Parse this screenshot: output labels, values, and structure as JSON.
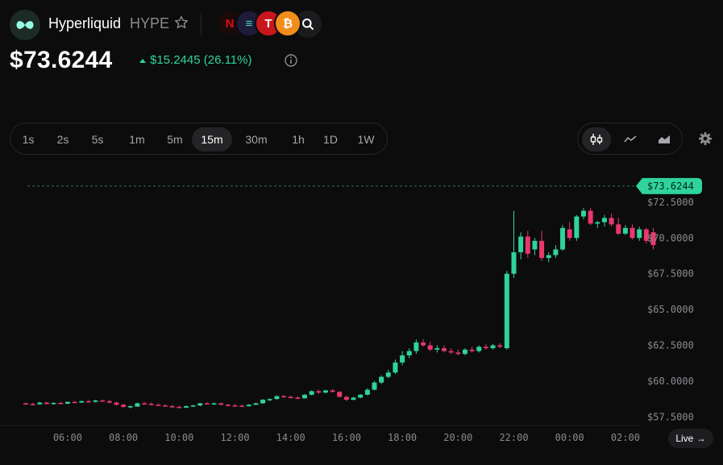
{
  "header": {
    "asset_name": "Hyperliquid",
    "ticker": "HYPE",
    "star_icon": "star-outline-icon",
    "tokens": [
      {
        "name": "netflix-logo",
        "glyph": "N",
        "bg": "#1a0a0a",
        "fg": "#e50914"
      },
      {
        "name": "solana-logo",
        "glyph": "≡",
        "bg": "#1e1a3a",
        "fg": "#3fd6c4"
      },
      {
        "name": "tesla-logo",
        "glyph": "T",
        "bg": "#c8161d",
        "fg": "#ffffff"
      },
      {
        "name": "bitcoin-logo",
        "glyph": "₿",
        "bg": "#f28c1a",
        "fg": "#ffffff"
      }
    ],
    "search_icon": "search-icon"
  },
  "price": {
    "value": "$73.6244",
    "change": "$15.2445 (26.11%)",
    "direction": "up",
    "change_color": "#2fd39b"
  },
  "timeframes": {
    "items": [
      "1s",
      "2s",
      "5s",
      "1m",
      "5m",
      "15m",
      "30m",
      "1h",
      "1D",
      "1W"
    ],
    "active": "15m"
  },
  "chart_types": {
    "items": [
      "candlestick-icon",
      "line-chart-icon",
      "area-chart-icon"
    ],
    "active": "candlestick-icon"
  },
  "settings_icon": "gear-icon",
  "live_button": {
    "label": "Live →"
  },
  "colors": {
    "up": "#2fd39b",
    "down": "#e8386c",
    "background": "#0c0c0d"
  },
  "chart_data": {
    "type": "candlestick",
    "interval": "15m",
    "last_price_label": "$73.6244",
    "last_price": 73.6244,
    "y_ticks": [
      "$72.5000",
      "$70.0000",
      "$67.5000",
      "$65.0000",
      "$62.5000",
      "$60.0000",
      "$57.5000"
    ],
    "y_tick_values": [
      72.5,
      70,
      67.5,
      65,
      62.5,
      60,
      57.5
    ],
    "x_ticks": [
      "06:00",
      "08:00",
      "10:00",
      "12:00",
      "14:00",
      "16:00",
      "18:00",
      "20:00",
      "22:00",
      "00:00",
      "02:00"
    ],
    "ylim": [
      56.9,
      74.8
    ],
    "candles": [
      [
        58.45,
        58.5,
        58.35,
        58.4
      ],
      [
        58.4,
        58.48,
        58.32,
        58.38
      ],
      [
        58.38,
        58.55,
        58.35,
        58.5
      ],
      [
        58.5,
        58.55,
        58.38,
        58.4
      ],
      [
        58.4,
        58.52,
        58.36,
        58.48
      ],
      [
        58.48,
        58.55,
        58.4,
        58.42
      ],
      [
        58.42,
        58.58,
        58.4,
        58.55
      ],
      [
        58.55,
        58.62,
        58.45,
        58.5
      ],
      [
        58.5,
        58.65,
        58.48,
        58.6
      ],
      [
        58.6,
        58.68,
        58.5,
        58.55
      ],
      [
        58.55,
        58.7,
        58.52,
        58.65
      ],
      [
        58.65,
        58.72,
        58.55,
        58.6
      ],
      [
        58.6,
        58.7,
        58.45,
        58.5
      ],
      [
        58.5,
        58.58,
        58.3,
        58.35
      ],
      [
        58.35,
        58.42,
        58.15,
        58.2
      ],
      [
        58.2,
        58.3,
        58.1,
        58.25
      ],
      [
        58.22,
        58.5,
        58.2,
        58.45
      ],
      [
        58.45,
        58.55,
        58.38,
        58.42
      ],
      [
        58.42,
        58.5,
        58.3,
        58.35
      ],
      [
        58.35,
        58.45,
        58.28,
        58.3
      ],
      [
        58.3,
        58.4,
        58.22,
        58.25
      ],
      [
        58.25,
        58.35,
        58.15,
        58.2
      ],
      [
        58.2,
        58.3,
        58.12,
        58.15
      ],
      [
        58.15,
        58.3,
        58.12,
        58.25
      ],
      [
        58.25,
        58.35,
        58.2,
        58.3
      ],
      [
        58.3,
        58.48,
        58.25,
        58.45
      ],
      [
        58.45,
        58.52,
        58.38,
        58.4
      ],
      [
        58.4,
        58.5,
        58.35,
        58.45
      ],
      [
        58.45,
        58.5,
        58.3,
        58.35
      ],
      [
        58.35,
        58.42,
        58.25,
        58.3
      ],
      [
        58.3,
        58.4,
        58.22,
        58.28
      ],
      [
        58.28,
        58.38,
        58.2,
        58.25
      ],
      [
        58.25,
        58.4,
        58.22,
        58.35
      ],
      [
        58.35,
        58.5,
        58.32,
        58.45
      ],
      [
        58.45,
        58.75,
        58.42,
        58.7
      ],
      [
        58.7,
        58.8,
        58.6,
        58.75
      ],
      [
        58.75,
        59.0,
        58.7,
        58.95
      ],
      [
        58.95,
        59.05,
        58.85,
        58.9
      ],
      [
        58.9,
        59.0,
        58.8,
        58.85
      ],
      [
        58.85,
        58.95,
        58.75,
        58.8
      ],
      [
        58.8,
        59.1,
        58.78,
        59.05
      ],
      [
        59.05,
        59.35,
        59.0,
        59.3
      ],
      [
        59.3,
        59.4,
        59.1,
        59.2
      ],
      [
        59.2,
        59.4,
        59.15,
        59.35
      ],
      [
        59.35,
        59.45,
        59.2,
        59.25
      ],
      [
        59.25,
        59.3,
        58.85,
        58.9
      ],
      [
        58.9,
        59.0,
        58.6,
        58.7
      ],
      [
        58.7,
        58.9,
        58.65,
        58.85
      ],
      [
        58.85,
        59.1,
        58.8,
        59.05
      ],
      [
        59.05,
        59.5,
        59.0,
        59.4
      ],
      [
        59.4,
        60.0,
        59.35,
        59.9
      ],
      [
        59.9,
        60.4,
        59.8,
        60.3
      ],
      [
        60.3,
        60.8,
        60.2,
        60.6
      ],
      [
        60.6,
        61.5,
        60.5,
        61.3
      ],
      [
        61.3,
        62.1,
        61.1,
        61.8
      ],
      [
        61.8,
        62.3,
        61.6,
        62.1
      ],
      [
        62.1,
        62.9,
        61.9,
        62.7
      ],
      [
        62.7,
        62.95,
        62.4,
        62.5
      ],
      [
        62.5,
        62.75,
        62.1,
        62.2
      ],
      [
        62.2,
        62.5,
        62.0,
        62.3
      ],
      [
        62.3,
        62.5,
        62.0,
        62.1
      ],
      [
        62.1,
        62.3,
        61.9,
        62.0
      ],
      [
        62.0,
        62.2,
        61.8,
        61.9
      ],
      [
        61.9,
        62.3,
        61.8,
        62.2
      ],
      [
        62.2,
        62.4,
        62.0,
        62.1
      ],
      [
        62.1,
        62.5,
        62.0,
        62.4
      ],
      [
        62.4,
        62.6,
        62.2,
        62.3
      ],
      [
        62.3,
        62.6,
        62.2,
        62.5
      ],
      [
        62.5,
        62.65,
        62.3,
        62.4
      ],
      [
        62.3,
        67.7,
        62.2,
        67.5
      ],
      [
        67.5,
        71.9,
        67.2,
        69.0
      ],
      [
        69.0,
        70.4,
        68.5,
        70.1
      ],
      [
        70.1,
        70.5,
        68.6,
        68.9
      ],
      [
        69.2,
        70.0,
        68.8,
        69.8
      ],
      [
        69.8,
        70.5,
        68.4,
        68.6
      ],
      [
        68.6,
        69.0,
        68.3,
        68.8
      ],
      [
        68.8,
        69.5,
        68.6,
        69.2
      ],
      [
        69.2,
        70.9,
        69.1,
        70.7
      ],
      [
        70.6,
        71.1,
        69.8,
        70.0
      ],
      [
        70.0,
        71.6,
        69.8,
        71.5
      ],
      [
        71.5,
        72.1,
        71.3,
        71.9
      ],
      [
        71.9,
        72.1,
        70.9,
        71.0
      ],
      [
        71.0,
        71.2,
        70.7,
        71.1
      ],
      [
        71.1,
        71.6,
        70.8,
        71.4
      ],
      [
        71.4,
        71.7,
        70.8,
        70.95
      ],
      [
        70.95,
        71.4,
        70.2,
        70.3
      ],
      [
        70.3,
        70.9,
        70.2,
        70.7
      ],
      [
        70.7,
        70.95,
        69.9,
        70.0
      ],
      [
        70.0,
        70.8,
        69.8,
        70.6
      ],
      [
        70.6,
        70.7,
        69.6,
        69.8
      ],
      [
        70.4,
        70.7,
        69.2,
        69.5
      ]
    ]
  }
}
